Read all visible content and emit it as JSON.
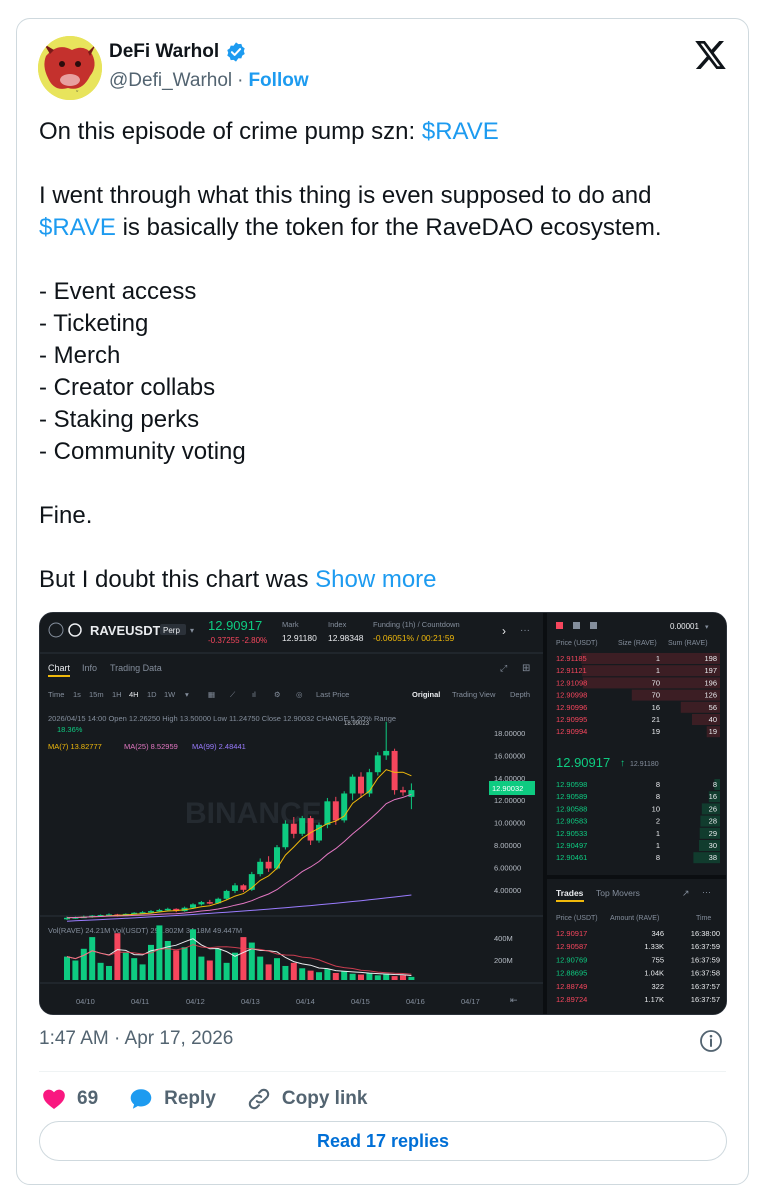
{
  "author": {
    "display_name": "DeFi Warhol",
    "handle": "@Defi_Warhol",
    "separator": "·",
    "follow_label": "Follow"
  },
  "tweet": {
    "line1_prefix": "On this episode of crime pump szn: ",
    "line1_cashtag": "$RAVE",
    "line2": "I went through what this thing is even supposed to do and",
    "line3_cashtag": "$RAVE",
    "line3_suffix": " is basically the token for the RaveDAO ecosystem.",
    "bullets": [
      "- Event access",
      "- Ticketing",
      "- Merch",
      "- Creator collabs",
      "- Staking perks",
      "- Community voting"
    ],
    "fine": "Fine.",
    "last_line": "But I doubt this chart was ",
    "show_more": "Show more"
  },
  "chart_shot": {
    "symbol": "RAVEUSDT",
    "perp_badge": "Perp",
    "price": "12.90917",
    "change": "-0.37255 -2.80%",
    "mark_label": "Mark",
    "mark_value": "12.91180",
    "index_label": "Index",
    "index_value": "12.98348",
    "funding_label": "Funding (1h) / Countdown",
    "funding_value": "-0.06051% / 00:21:59",
    "tabs": [
      "Chart",
      "Info",
      "Trading Data"
    ],
    "intervals": [
      "Time",
      "1s",
      "15m",
      "1H",
      "4H",
      "1D",
      "1W"
    ],
    "last_price": "Last Price",
    "views": [
      "Original",
      "Trading View",
      "Depth"
    ],
    "ohlc": "2026/04/15 14:00  Open 12.26250  High 13.50000  Low 11.24750  Close 12.90032  CHANGE 5.20%  Range",
    "range": "18.36%",
    "ma7": "MA(7) 13.82777",
    "ma25": "MA(25) 8.52959",
    "ma99": "MA(99) 2.48441",
    "peak_label": "18.99023",
    "price_axis": [
      "18.00000",
      "16.00000",
      "14.00000",
      "12.00000",
      "10.00000",
      "8.00000",
      "6.00000",
      "4.00000"
    ],
    "current_tag": "12.90032",
    "vol_text": "Vol(RAVE) 24.21M  Vol(USDT) 291.802M  34.18M  49.447M",
    "vol_axis": [
      "400M",
      "200M"
    ],
    "dates": [
      "04/10",
      "04/11",
      "04/12",
      "04/13",
      "04/14",
      "04/15",
      "04/16",
      "04/17"
    ],
    "watermark": "BINANCE",
    "book_tick": "0.00001",
    "book_headers": [
      "Price (USDT)",
      "Size (RAVE)",
      "Sum (RAVE)"
    ],
    "asks": [
      [
        "12.91185",
        "1",
        "198"
      ],
      [
        "12.91121",
        "1",
        "197"
      ],
      [
        "12.91098",
        "70",
        "196"
      ],
      [
        "12.90998",
        "70",
        "126"
      ],
      [
        "12.90996",
        "16",
        "56"
      ],
      [
        "12.90995",
        "21",
        "40"
      ],
      [
        "12.90994",
        "19",
        "19"
      ]
    ],
    "mid_price": "12.90917",
    "mid_arrow": "↑",
    "mid_mark": "12.91180",
    "bids": [
      [
        "12.90598",
        "8",
        "8"
      ],
      [
        "12.90589",
        "8",
        "16"
      ],
      [
        "12.90588",
        "10",
        "26"
      ],
      [
        "12.90583",
        "2",
        "28"
      ],
      [
        "12.90533",
        "1",
        "29"
      ],
      [
        "12.90497",
        "1",
        "30"
      ],
      [
        "12.90461",
        "8",
        "38"
      ]
    ],
    "trades_tabs": [
      "Trades",
      "Top Movers"
    ],
    "trades_headers": [
      "Price (USDT)",
      "Amount (RAVE)",
      "Time"
    ],
    "trades": [
      [
        "12.90917",
        "346",
        "16:38:00",
        "red"
      ],
      [
        "12.90587",
        "1.33K",
        "16:37:59",
        "red"
      ],
      [
        "12.90769",
        "755",
        "16:37:59",
        "green"
      ],
      [
        "12.88695",
        "1.04K",
        "16:37:58",
        "green"
      ],
      [
        "12.88749",
        "322",
        "16:37:57",
        "red"
      ],
      [
        "12.89724",
        "1.17K",
        "16:37:57",
        "red"
      ]
    ]
  },
  "meta": {
    "timestamp": "1:47 AM · Apr 17, 2026"
  },
  "actions": {
    "likes": "69",
    "reply": "Reply",
    "copy_link": "Copy link"
  },
  "read_replies": "Read 17 replies",
  "colors": {
    "link": "#1d9bf0",
    "like": "#f91880",
    "up": "#0ecb81",
    "down": "#f6465d"
  }
}
